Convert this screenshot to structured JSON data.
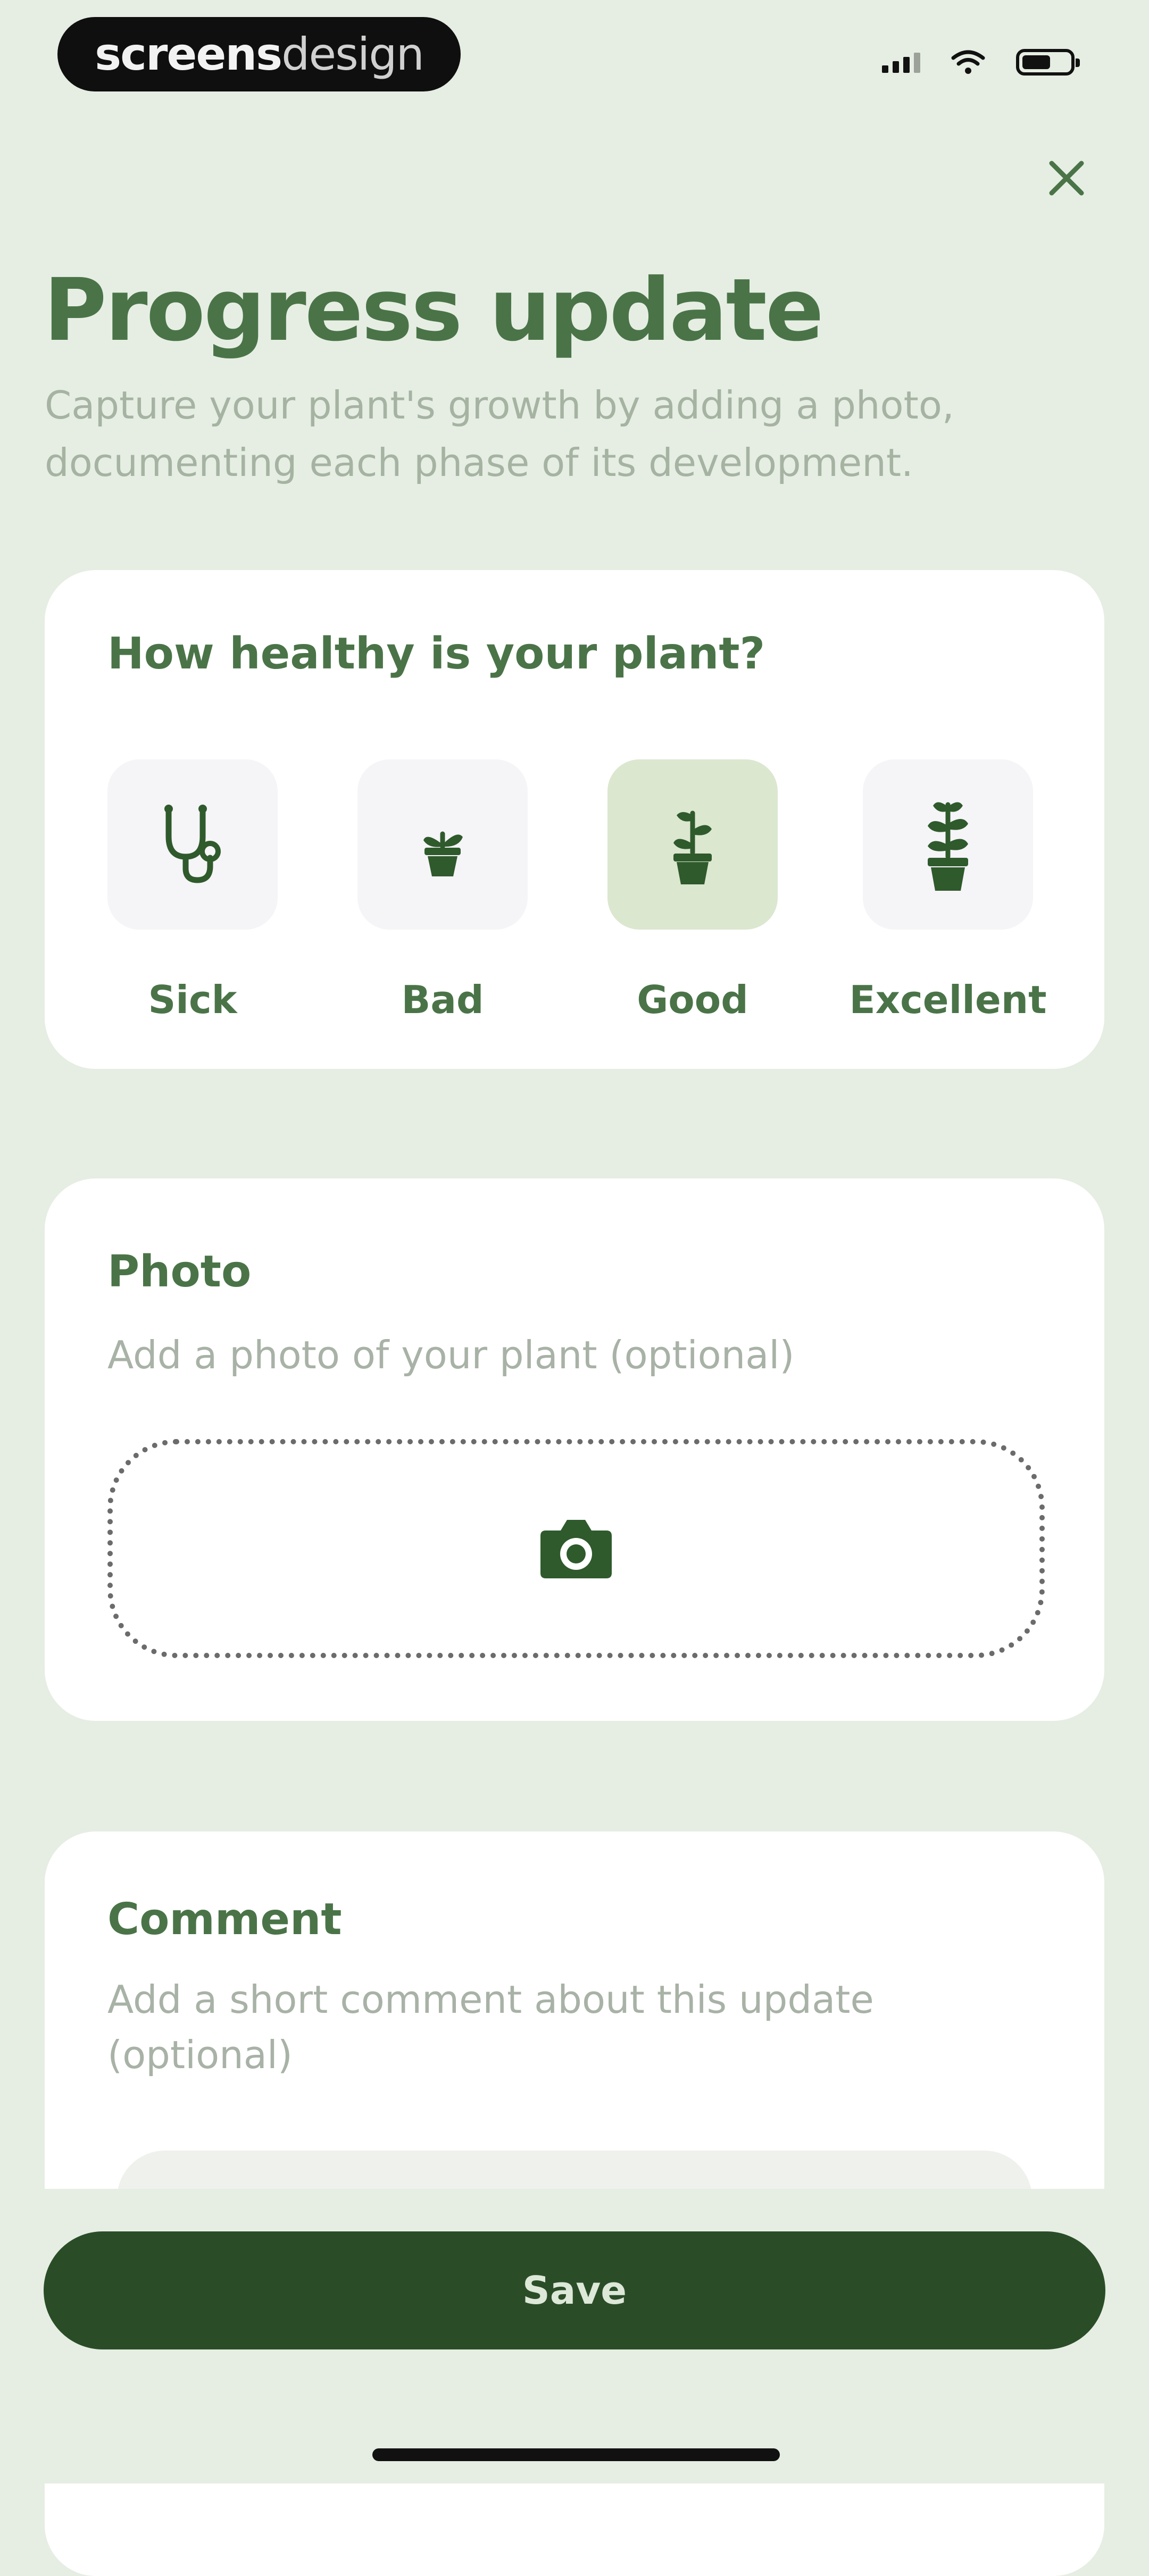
{
  "status_bar": {
    "brand_bold": "screens",
    "brand_light": "design"
  },
  "header": {
    "title": "Progress update",
    "subtitle": "Capture your plant's growth by adding a photo, documenting each phase of its development."
  },
  "health": {
    "question": "How healthy is your plant?",
    "selected": "Good",
    "options": [
      {
        "label": "Sick",
        "icon": "stethoscope-icon"
      },
      {
        "label": "Bad",
        "icon": "small-plant-icon"
      },
      {
        "label": "Good",
        "icon": "medium-plant-icon"
      },
      {
        "label": "Excellent",
        "icon": "large-plant-icon"
      }
    ]
  },
  "photo": {
    "title": "Photo",
    "subtitle": "Add a photo of your plant (optional)",
    "icon": "camera-icon"
  },
  "comment": {
    "title": "Comment",
    "subtitle": "Add a short comment about this update (optional)"
  },
  "actions": {
    "save_label": "Save"
  },
  "colors": {
    "background": "#e6eee3",
    "accent": "#4a7448",
    "button": "#2a4d27",
    "icon_dark": "#2f5a2c",
    "selected_bg": "#dbe7cf"
  }
}
